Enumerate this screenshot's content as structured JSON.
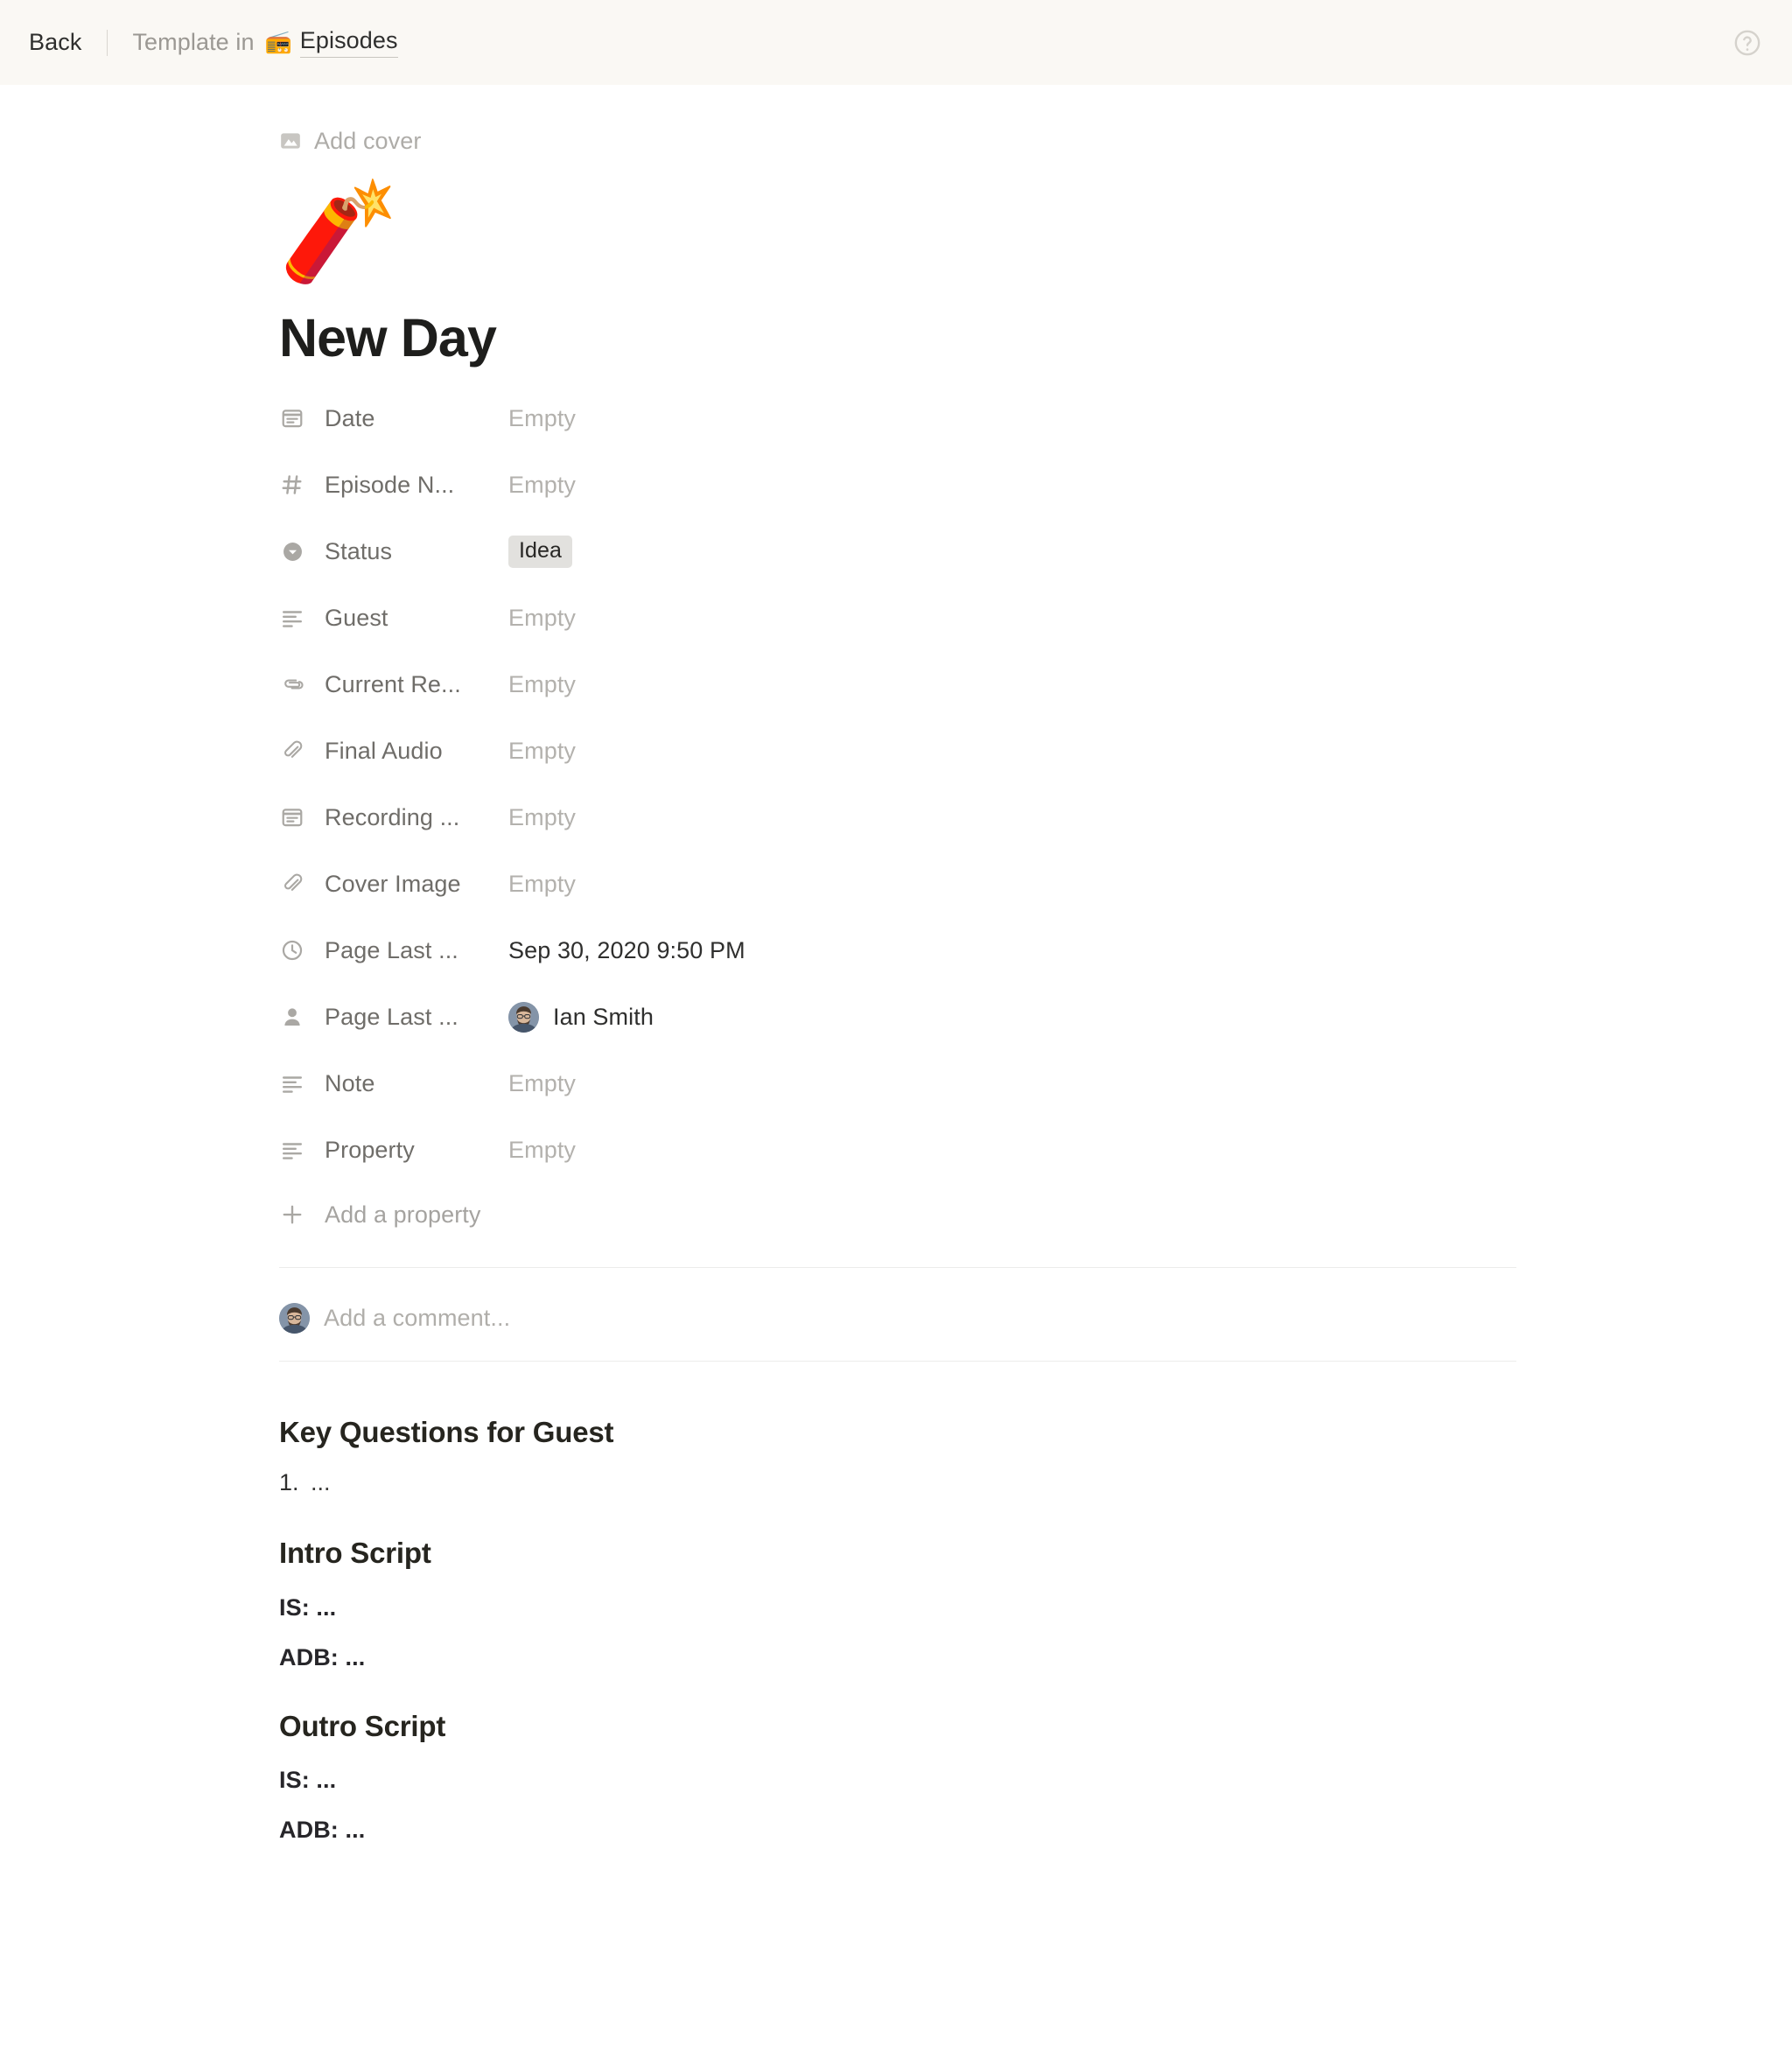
{
  "topbar": {
    "back_label": "Back",
    "template_in_label": "Template in",
    "database_emoji": "📻",
    "database_name": "Episodes",
    "help_icon": "help-circle-icon"
  },
  "page": {
    "add_cover_label": "Add cover",
    "add_cover_icon": "image-icon",
    "page_emoji": "🧨",
    "title": "New Day"
  },
  "properties": {
    "add_property_label": "Add a property",
    "add_property_icon": "plus-icon",
    "rows": [
      {
        "icon": "calendar-icon",
        "name": "Date",
        "value": "Empty",
        "type": "empty"
      },
      {
        "icon": "hash-icon",
        "name": "Episode N...",
        "value": "Empty",
        "type": "empty"
      },
      {
        "icon": "select-icon",
        "name": "Status",
        "value": "Idea",
        "type": "tag"
      },
      {
        "icon": "text-icon",
        "name": "Guest",
        "value": "Empty",
        "type": "empty"
      },
      {
        "icon": "files-icon",
        "name": "Current Re...",
        "value": "Empty",
        "type": "empty"
      },
      {
        "icon": "paperclip-icon",
        "name": "Final Audio",
        "value": "Empty",
        "type": "empty"
      },
      {
        "icon": "calendar-icon",
        "name": "Recording ...",
        "value": "Empty",
        "type": "empty"
      },
      {
        "icon": "paperclip-icon",
        "name": "Cover Image",
        "value": "Empty",
        "type": "empty"
      },
      {
        "icon": "clock-icon",
        "name": "Page Last ...",
        "value": "Sep 30, 2020 9:50 PM",
        "type": "text"
      },
      {
        "icon": "person-icon",
        "name": "Page Last ...",
        "value": "Ian Smith",
        "type": "person"
      },
      {
        "icon": "text-icon",
        "name": "Note",
        "value": "Empty",
        "type": "empty"
      },
      {
        "icon": "text-icon",
        "name": "Property",
        "value": "Empty",
        "type": "empty"
      }
    ]
  },
  "comment": {
    "placeholder": "Add a comment...",
    "avatar_icon": "user-avatar"
  },
  "content": {
    "key_questions_heading": "Key Questions for Guest",
    "key_questions_marker": "1.",
    "key_questions_item": "...",
    "intro_heading": "Intro Script",
    "intro_is": "IS: ...",
    "intro_adb": "ADB: ...",
    "outro_heading": "Outro Script",
    "outro_is": "IS: ...",
    "outro_adb": "ADB: ..."
  },
  "colors": {
    "topbar_background": "#faf8f4",
    "page_background": "#ffffff",
    "text_primary": "#2f2f2e",
    "text_muted": "#9b9893",
    "placeholder": "#b3b1ad",
    "tag_background": "#e2e1de",
    "divider": "#ececeb"
  }
}
